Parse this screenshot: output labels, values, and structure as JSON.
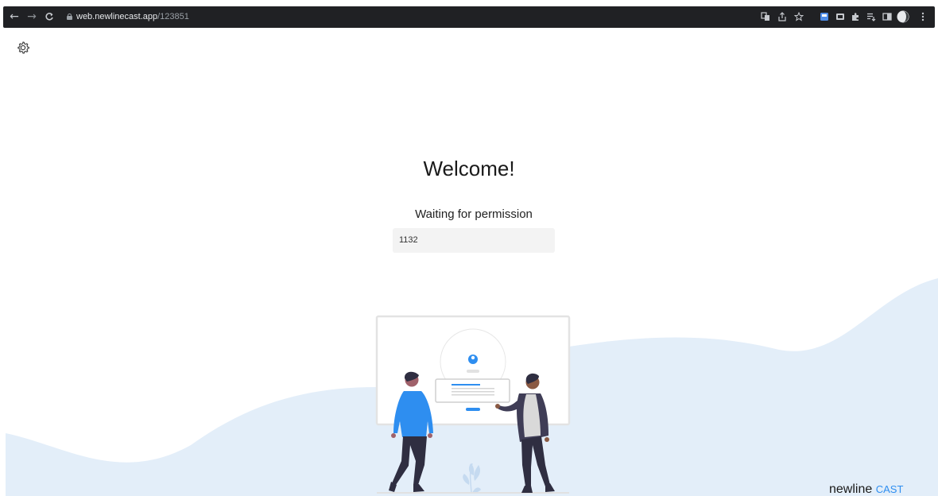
{
  "browser": {
    "url_host": "web.newlinecast.app",
    "url_path": "/123851",
    "back_icon": "arrow-left-icon",
    "forward_icon": "arrow-right-icon",
    "reload_icon": "reload-icon",
    "lock_icon": "lock-icon"
  },
  "page": {
    "settings_icon": "gear-icon",
    "welcome": "Welcome!",
    "status": "Waiting for permission",
    "code": "1132"
  },
  "brand": {
    "name_part1": "newline",
    "name_part2": "CAST"
  },
  "colors": {
    "accent": "#2e8ef0",
    "wave": "#e3eef9",
    "chrome": "#202124"
  }
}
